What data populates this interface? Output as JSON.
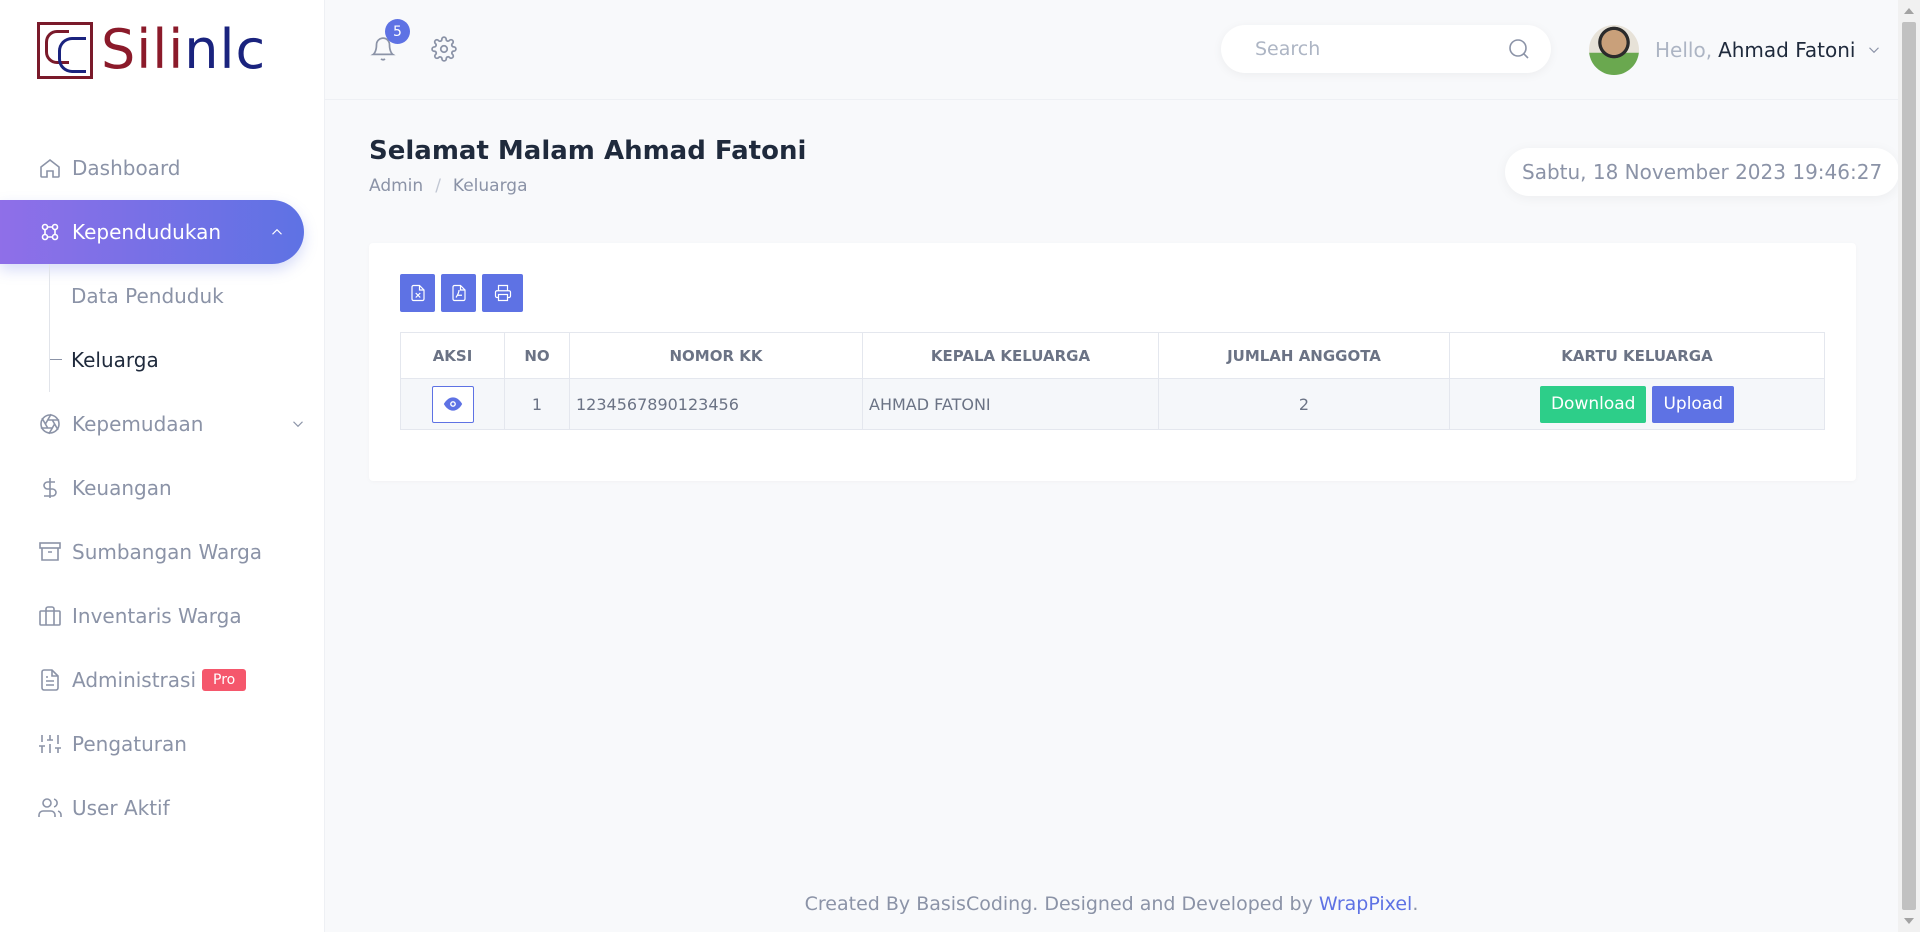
{
  "brand": {
    "logo_left": "Sili",
    "logo_right": "nlc"
  },
  "sidebar": {
    "items": [
      {
        "label": "Dashboard",
        "icon": "home-icon"
      },
      {
        "label": "Kependudukan",
        "icon": "users-cluster-icon"
      },
      {
        "label": "Kepemudaan",
        "icon": "aperture-icon"
      },
      {
        "label": "Keuangan",
        "icon": "dollar-icon"
      },
      {
        "label": "Sumbangan Warga",
        "icon": "archive-icon"
      },
      {
        "label": "Inventaris Warga",
        "icon": "briefcase-icon"
      },
      {
        "label": "Administrasi",
        "icon": "document-icon",
        "badge": "Pro"
      },
      {
        "label": "Pengaturan",
        "icon": "sliders-icon"
      },
      {
        "label": "User Aktif",
        "icon": "user-icon"
      }
    ],
    "submenu": [
      {
        "label": "Data Penduduk"
      },
      {
        "label": "Keluarga"
      }
    ]
  },
  "topbar": {
    "notification_count": "5",
    "search_placeholder": "Search",
    "hello": "Hello,",
    "user_name": "Ahmad Fatoni"
  },
  "page": {
    "title": "Selamat Malam Ahmad Fatoni",
    "breadcrumb": [
      "Admin",
      "/",
      "Keluarga"
    ],
    "datetime": "Sabtu, 18 November 2023 19:46:27"
  },
  "table": {
    "headers": [
      "AKSI",
      "NO",
      "NOMOR KK",
      "KEPALA KELUARGA",
      "JUMLAH ANGGOTA",
      "KARTU KELUARGA"
    ],
    "rows": [
      {
        "no": "1",
        "nomor_kk": "1234567890123456",
        "kepala": "AHMAD FATONI",
        "jumlah": "2"
      }
    ],
    "download_label": "Download",
    "upload_label": "Upload"
  },
  "footer": {
    "text": "Created By BasisCoding. Designed and Developed by",
    "link": "WrapPixel",
    "end": "."
  },
  "colors": {
    "accent": "#5e72e4",
    "accent_gradient_start": "#8f6fe8",
    "success": "#2dce89",
    "danger": "#f5576c",
    "brand_red": "#8b1a2a",
    "brand_blue": "#1a237e"
  }
}
